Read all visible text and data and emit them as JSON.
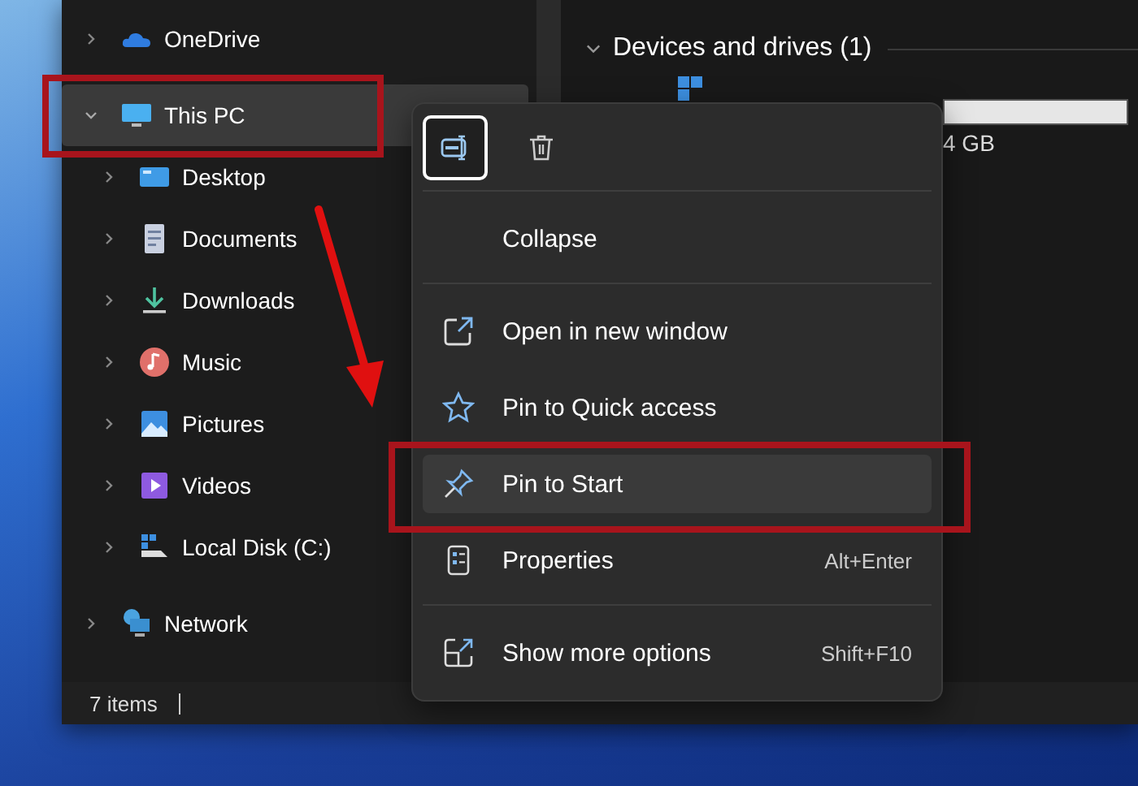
{
  "sidebar": {
    "items": [
      {
        "label": "OneDrive",
        "kind": "cloud",
        "expanded": false,
        "selected": false
      },
      {
        "label": "This PC",
        "kind": "monitor",
        "expanded": true,
        "selected": true,
        "children": [
          {
            "label": "Desktop",
            "kind": "desktop",
            "expanded": false,
            "selected": false
          },
          {
            "label": "Documents",
            "kind": "document",
            "expanded": false,
            "selected": false
          },
          {
            "label": "Downloads",
            "kind": "download",
            "expanded": false,
            "selected": false
          },
          {
            "label": "Music",
            "kind": "music",
            "expanded": false,
            "selected": false
          },
          {
            "label": "Pictures",
            "kind": "picture",
            "expanded": false,
            "selected": false
          },
          {
            "label": "Videos",
            "kind": "video",
            "expanded": false,
            "selected": false
          },
          {
            "label": "Local Disk (C:)",
            "kind": "disk",
            "expanded": false,
            "selected": false
          }
        ]
      },
      {
        "label": "Network",
        "kind": "network",
        "expanded": false,
        "selected": false
      }
    ]
  },
  "main": {
    "section": {
      "title": "Devices and drives (1)",
      "expanded": true
    },
    "drive": {
      "size_text": "4 GB"
    }
  },
  "status_bar": {
    "count": "7 items"
  },
  "context_menu": {
    "toolbar": [
      {
        "kind": "rename",
        "selected": true
      },
      {
        "kind": "delete",
        "selected": false
      }
    ],
    "groups": [
      [
        {
          "label": "Collapse",
          "kind": "none",
          "selected": false
        }
      ],
      [
        {
          "label": "Open in new window",
          "kind": "open",
          "selected": false
        },
        {
          "label": "Pin to Quick access",
          "kind": "star",
          "selected": false
        },
        {
          "label": "Pin to Start",
          "kind": "pin",
          "selected": true
        },
        {
          "label": "Properties",
          "kind": "properties",
          "shortcut": "Alt+Enter",
          "selected": false
        }
      ],
      [
        {
          "label": "Show more options",
          "kind": "more",
          "shortcut": "Shift+F10",
          "selected": false
        }
      ]
    ]
  },
  "annotations": [
    {
      "kind": "frame"
    },
    {
      "kind": "frame"
    },
    {
      "kind": "arrow"
    }
  ]
}
